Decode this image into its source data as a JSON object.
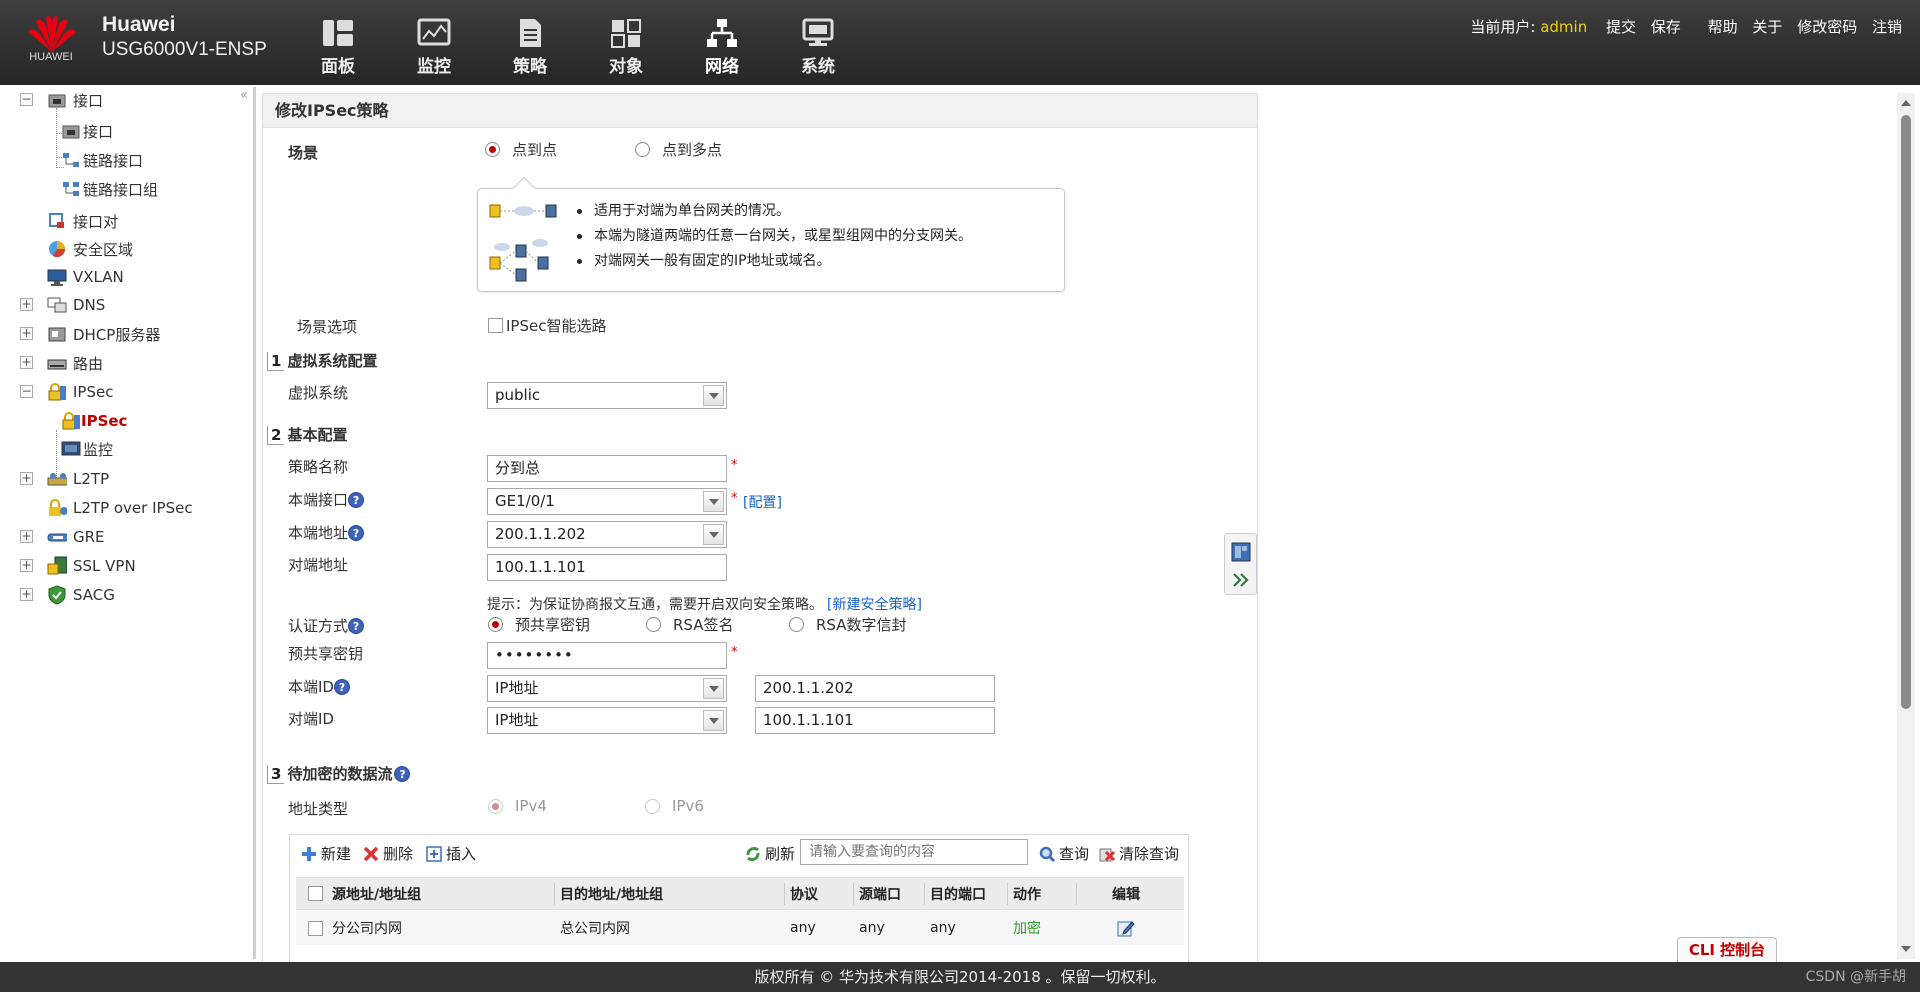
{
  "header": {
    "logo_text": "HUAWEI",
    "brand_line1": "Huawei",
    "brand_line2": "USG6000V1-ENSP",
    "nav": [
      {
        "label": "面板",
        "icon": "dashboard-icon"
      },
      {
        "label": "监控",
        "icon": "monitor-icon"
      },
      {
        "label": "策略",
        "icon": "policy-icon"
      },
      {
        "label": "对象",
        "icon": "object-icon"
      },
      {
        "label": "网络",
        "icon": "network-icon"
      },
      {
        "label": "系统",
        "icon": "system-icon"
      }
    ],
    "current_user_label": "当前用户:",
    "current_user": "admin",
    "links": {
      "submit": "提交",
      "save": "保存",
      "help": "帮助",
      "about": "关于",
      "change_password": "修改密码",
      "logout": "注销"
    }
  },
  "sidebar": {
    "items": [
      {
        "label": "接口"
      },
      {
        "label": "接口"
      },
      {
        "label": "链路接口"
      },
      {
        "label": "链路接口组"
      },
      {
        "label": "接口对"
      },
      {
        "label": "安全区域"
      },
      {
        "label": "VXLAN"
      },
      {
        "label": "DNS"
      },
      {
        "label": "DHCP服务器"
      },
      {
        "label": "路由"
      },
      {
        "label": "IPSec"
      },
      {
        "label": "IPSec"
      },
      {
        "label": "监控"
      },
      {
        "label": "L2TP"
      },
      {
        "label": "L2TP over IPSec"
      },
      {
        "label": "GRE"
      },
      {
        "label": "SSL VPN"
      },
      {
        "label": "SACG"
      }
    ]
  },
  "panel": {
    "title": "修改IPSec策略",
    "scenario": {
      "label": "场景",
      "options": [
        "点到点",
        "点到多点"
      ],
      "selected": "点到点",
      "info": [
        "适用于对端为单台网关的情况。",
        "本端为隧道两端的任意一台网关，或星型组网中的分支网关。",
        "对端网关一般有固定的IP地址或域名。"
      ]
    },
    "scenario_options": {
      "label": "场景选项",
      "checkbox_label": "IPSec智能选路"
    },
    "section1": {
      "num": "1",
      "title": "虚拟系统配置",
      "vsys_label": "虚拟系统",
      "vsys_value": "public"
    },
    "section2": {
      "num": "2",
      "title": "基本配置",
      "policy_name_label": "策略名称",
      "policy_name_value": "分到总",
      "local_if_label": "本端接口",
      "local_if_value": "GE1/0/1",
      "config_link": "[配置]",
      "local_addr_label": "本端地址",
      "local_addr_value": "200.1.1.202",
      "peer_addr_label": "对端地址",
      "peer_addr_value": "100.1.1.101",
      "hint": "提示：为保证协商报文互通，需要开启双向安全策略。",
      "hint_link": "[新建安全策略]",
      "auth_label": "认证方式",
      "auth_options": [
        "预共享密钥",
        "RSA签名",
        "RSA数字信封"
      ],
      "auth_selected": "预共享密钥",
      "psk_label": "预共享密钥",
      "psk_value": "••••••••",
      "local_id_label": "本端ID",
      "local_id_type": "IP地址",
      "local_id_value": "200.1.1.202",
      "peer_id_label": "对端ID",
      "peer_id_type": "IP地址",
      "peer_id_value": "100.1.1.101",
      "required_mark": "*"
    },
    "section3": {
      "num": "3",
      "title": "待加密的数据流",
      "addr_type_label": "地址类型",
      "addr_type_options": [
        "IPv4",
        "IPv6"
      ],
      "addr_type_selected": "IPv4",
      "toolbar": {
        "new": "新建",
        "delete": "删除",
        "insert": "插入",
        "refresh": "刷新",
        "search_placeholder": "请输入要查询的内容",
        "query": "查询",
        "clear_query": "清除查询"
      },
      "columns": [
        "源地址/地址组",
        "目的地址/地址组",
        "协议",
        "源端口",
        "目的端口",
        "动作",
        "编辑"
      ],
      "rows": [
        {
          "src": "分公司内网",
          "dst": "总公司内网",
          "proto": "any",
          "sport": "any",
          "dport": "any",
          "action": "加密"
        }
      ]
    }
  },
  "cli_button": "CLI 控制台",
  "footer": {
    "copyright": "版权所有 © 华为技术有限公司2014-2018 。保留一切权利。",
    "watermark": "CSDN @新手胡"
  },
  "colors": {
    "header_bg": "#333333",
    "active_red": "#c00000",
    "user_yellow": "#f0d000",
    "link_blue": "#1763c8",
    "action_green": "#2e9a2e"
  }
}
